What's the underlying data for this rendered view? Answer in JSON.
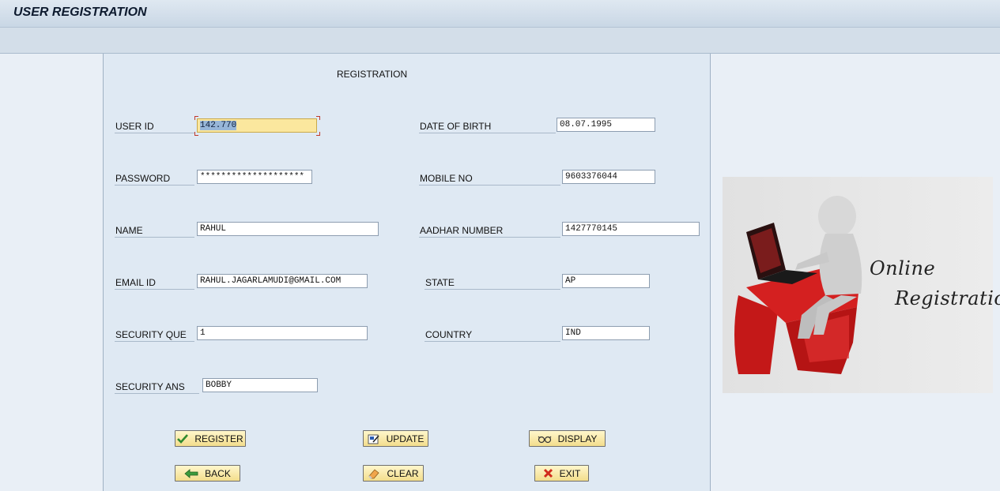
{
  "window": {
    "title": "USER REGISTRATION"
  },
  "form": {
    "heading": "REGISTRATION",
    "left_fields": [
      {
        "label": "USER ID",
        "value": "142.770"
      },
      {
        "label": "PASSWORD",
        "value": "********************"
      },
      {
        "label": "NAME",
        "value": "RAHUL"
      },
      {
        "label": "EMAIL ID",
        "value": "RAHUL.JAGARLAMUDI@GMAIL.COM"
      },
      {
        "label": "SECURITY QUE",
        "value": "1"
      },
      {
        "label": "SECURITY ANS",
        "value": "BOBBY"
      }
    ],
    "right_fields": [
      {
        "label": "DATE OF BIRTH",
        "value": "08.07.1995"
      },
      {
        "label": "MOBILE NO",
        "value": "9603376044"
      },
      {
        "label": "AADHAR NUMBER",
        "value": "1427770145"
      },
      {
        "label": "STATE",
        "value": "AP"
      },
      {
        "label": "COUNTRY",
        "value": "IND"
      }
    ]
  },
  "buttons": {
    "register": "REGISTER",
    "update": "UPDATE",
    "display": "DISPLAY",
    "back": "BACK",
    "clear": "CLEAR",
    "exit": "EXIT"
  },
  "illustration": {
    "line1": "Online",
    "line2": "Registration"
  },
  "icons": {
    "register": "checkmark-icon",
    "update": "edit-icon",
    "display": "glasses-icon",
    "back": "arrow-left-icon",
    "clear": "eraser-icon",
    "exit": "red-x-icon"
  }
}
